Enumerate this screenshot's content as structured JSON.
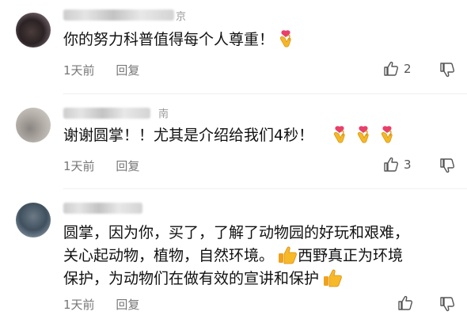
{
  "comments": [
    {
      "location": "京",
      "text": "你的努力科普值得每个人尊重！",
      "time": "1天前",
      "reply": "回复",
      "likes": "2",
      "emoji": [
        "crossed-fingers-heart"
      ]
    },
    {
      "location": "南",
      "text": "谢谢圆掌！！尤其是介绍给我们4秒！",
      "time": "1天前",
      "reply": "回复",
      "likes": "3",
      "emoji": [
        "crossed-fingers-heart",
        "crossed-fingers-heart",
        "crossed-fingers-heart"
      ]
    },
    {
      "location": "",
      "line1": "圆掌，因为你，买了，了解了动物园的好玩和艰难，",
      "line2a": "关心起动物，植物，自然环境。",
      "line2b": "西野真正为环境",
      "line3": "保护，为动物们在做有效的宣讲和保护",
      "time": "1天前",
      "reply": "回复",
      "likes": "",
      "emoji": [
        "thumbs-up",
        "thumbs-up"
      ]
    }
  ],
  "colors": {
    "emoji_yellow": "#f5b826",
    "emoji_heart": "#e8406a",
    "meta": "#777777"
  }
}
